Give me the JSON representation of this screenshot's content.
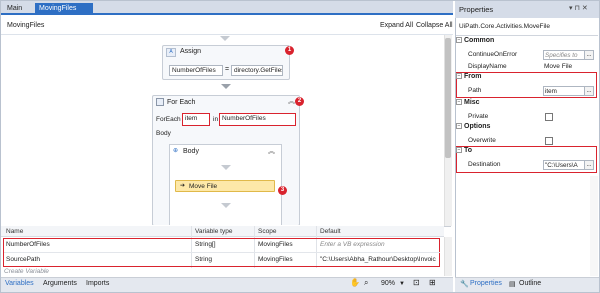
{
  "tabs": {
    "main": "Main",
    "moving": "MovingFiles *",
    "close": "✕"
  },
  "designer": {
    "breadcrumb": "MovingFiles",
    "expand_all": "Expand All",
    "collapse_all": "Collapse All"
  },
  "assign": {
    "title": "Assign",
    "to": "NumberOfFiles",
    "eq": "=",
    "value": "directory.GetFiles(",
    "badge": "1"
  },
  "foreach": {
    "title": "For Each",
    "foreach_label": "ForEach",
    "item": "item",
    "in_label": "in",
    "collection": "NumberOfFiles",
    "body_label": "Body",
    "badge": "2"
  },
  "body": {
    "title": "Body",
    "activity": "Move File",
    "badge": "3"
  },
  "variables": {
    "headers": [
      "Name",
      "Variable type",
      "Scope",
      "Default"
    ],
    "rows": [
      {
        "name": "NumberOfFiles",
        "type": "String[]",
        "scope": "MovingFiles",
        "default": "Enter a VB expression"
      },
      {
        "name": "SourcePath",
        "type": "String",
        "scope": "MovingFiles",
        "default": "\"C:\\Users\\Abha_Rathour\\Desktop\\Invoic"
      }
    ],
    "create": "Create Variable"
  },
  "bottom": {
    "variables": "Variables",
    "arguments": "Arguments",
    "imports": "Imports",
    "zoom": "90%"
  },
  "properties": {
    "title": "Properties",
    "activity": "UiPath.Core.Activities.MoveFile",
    "common": "Common",
    "continue_label": "ContinueOnError",
    "continue_value": "Specifies to",
    "display_label": "DisplayName",
    "display_value": "Move File",
    "from": "From",
    "path_label": "Path",
    "path_value": "item",
    "misc": "Misc",
    "private_label": "Private",
    "options": "Options",
    "overwrite_label": "Overwrite",
    "to": "To",
    "dest_label": "Destination",
    "dest_value": "\"C:\\Users\\A",
    "dots": "...",
    "tab_properties": "Properties",
    "tab_outline": "Outline"
  },
  "colors": {
    "accent": "#2e6fc4",
    "highlight": "#d9232e",
    "activity_fill": "#fde8a8"
  }
}
